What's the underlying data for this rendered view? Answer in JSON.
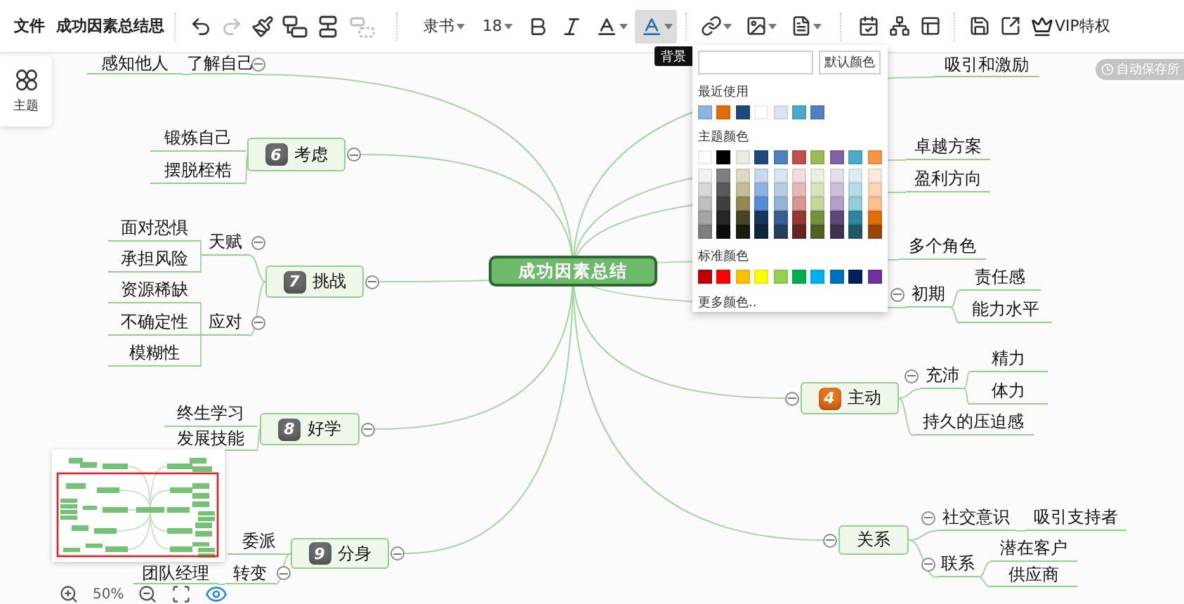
{
  "toolbar": {
    "menu": "文件",
    "title": "成功因素总结思",
    "edit_tools": [
      {
        "disabled": false
      },
      {
        "disabled": true
      },
      {
        "disabled": false
      },
      {
        "disabled": false
      },
      {
        "disabled": false
      },
      {
        "disabled": true
      }
    ],
    "font": "隶书",
    "font_size": "18",
    "format_tools": [
      {
        "active": false
      },
      {
        "active": false
      },
      {
        "active": false
      },
      {
        "active": true
      },
      {
        "active": false
      },
      {
        "active": false
      },
      {
        "active": false
      }
    ],
    "vip": "VIP特权"
  },
  "tooltip": "背景",
  "side_panel": {
    "theme_button": "主题"
  },
  "autosave": "自动保存所",
  "color_picker": {
    "default_button": "默认颜色",
    "recent_label": "最近使用",
    "recent": [
      {
        "color": "#8eb4e3"
      },
      {
        "color": "#e36c09"
      },
      {
        "color": "#1f497d"
      },
      {
        "color": "#ffffff"
      },
      {
        "color": "#dbe5f1"
      },
      {
        "color": "#4bacc6"
      },
      {
        "color": "#4f81bd"
      }
    ],
    "theme_label": "主题颜色",
    "theme_rows": [
      [
        {
          "color": "#ffffff"
        },
        {
          "color": "#000000"
        },
        {
          "color": "#eeece1"
        },
        {
          "color": "#1f497d"
        },
        {
          "color": "#4f81bd"
        },
        {
          "color": "#c0504d"
        },
        {
          "color": "#9bbb59"
        },
        {
          "color": "#8064a2"
        },
        {
          "color": "#4bacc6"
        },
        {
          "color": "#f79646"
        }
      ],
      [
        {
          "color": "#f2f2f2"
        },
        {
          "color": "#7f7f7f"
        },
        {
          "color": "#ddd9c3"
        },
        {
          "color": "#c6d9f0"
        },
        {
          "color": "#dbe5f1"
        },
        {
          "color": "#f2dcdb"
        },
        {
          "color": "#ebf1dd"
        },
        {
          "color": "#e5e0ec"
        },
        {
          "color": "#dbeef3"
        },
        {
          "color": "#fdeada"
        }
      ],
      [
        {
          "color": "#d8d8d8"
        },
        {
          "color": "#595959"
        },
        {
          "color": "#c4bd97"
        },
        {
          "color": "#8db3e2"
        },
        {
          "color": "#b8cce4"
        },
        {
          "color": "#e5b9b7"
        },
        {
          "color": "#d7e3bc"
        },
        {
          "color": "#ccc1d9"
        },
        {
          "color": "#b7dde8"
        },
        {
          "color": "#fbd5b5"
        }
      ],
      [
        {
          "color": "#bfbfbf"
        },
        {
          "color": "#3f3f3f"
        },
        {
          "color": "#938953"
        },
        {
          "color": "#548dd4"
        },
        {
          "color": "#95b3d7"
        },
        {
          "color": "#d99694"
        },
        {
          "color": "#c3d69b"
        },
        {
          "color": "#b2a2c7"
        },
        {
          "color": "#92cddc"
        },
        {
          "color": "#fac08f"
        }
      ],
      [
        {
          "color": "#a5a5a5"
        },
        {
          "color": "#262626"
        },
        {
          "color": "#494429"
        },
        {
          "color": "#17365d"
        },
        {
          "color": "#366092"
        },
        {
          "color": "#953734"
        },
        {
          "color": "#76923c"
        },
        {
          "color": "#5f497a"
        },
        {
          "color": "#31859b"
        },
        {
          "color": "#e36c09"
        }
      ],
      [
        {
          "color": "#7f7f7f"
        },
        {
          "color": "#0c0c0c"
        },
        {
          "color": "#1d1b10"
        },
        {
          "color": "#0f243e"
        },
        {
          "color": "#244061"
        },
        {
          "color": "#632423"
        },
        {
          "color": "#4f6128"
        },
        {
          "color": "#3f3151"
        },
        {
          "color": "#205867"
        },
        {
          "color": "#974806"
        }
      ]
    ],
    "standard_label": "标准颜色",
    "standard": [
      {
        "color": "#c00000"
      },
      {
        "color": "#ff0000"
      },
      {
        "color": "#ffc000"
      },
      {
        "color": "#ffff00"
      },
      {
        "color": "#92d050"
      },
      {
        "color": "#00b050"
      },
      {
        "color": "#00b0f0"
      },
      {
        "color": "#0070c0"
      },
      {
        "color": "#002060"
      },
      {
        "color": "#7030a0"
      }
    ],
    "more_link": "更多颜色.."
  },
  "mindmap": {
    "root": {
      "text": "成功因素总结",
      "kind": "center",
      "children": [
        {
          "text": "了解自己",
          "kind": "topic",
          "expanded": true,
          "children": [
            {
              "text": "感知他人",
              "kind": "topic"
            }
          ]
        },
        {
          "text": "考虑",
          "kind": "main",
          "badge": {
            "text": "6",
            "color": "#6b6b6b"
          },
          "expanded": true,
          "children": [
            {
              "text": "锻炼自己",
              "kind": "topic"
            },
            {
              "text": "摆脱桎梏",
              "kind": "topic"
            }
          ]
        },
        {
          "text": "挑战",
          "kind": "main",
          "badge": {
            "text": "7",
            "color": "#6b6b6b"
          },
          "expanded": true,
          "children": [
            {
              "text": "天赋",
              "kind": "topic",
              "expanded": true,
              "children": [
                {
                  "text": "面对恐惧",
                  "kind": "topic"
                },
                {
                  "text": "承担风险",
                  "kind": "topic"
                }
              ]
            },
            {
              "text": "应对",
              "kind": "topic",
              "expanded": true,
              "children": [
                {
                  "text": "资源稀缺",
                  "kind": "topic"
                },
                {
                  "text": "不确定性",
                  "kind": "topic"
                },
                {
                  "text": "模糊性",
                  "kind": "topic"
                }
              ]
            }
          ]
        },
        {
          "text": "好学",
          "kind": "main",
          "badge": {
            "text": "8",
            "color": "#6b6b6b"
          },
          "expanded": true,
          "children": [
            {
              "text": "终生学习",
              "kind": "topic"
            },
            {
              "text": "发展技能",
              "kind": "topic"
            }
          ]
        },
        {
          "text": "分身",
          "kind": "main",
          "badge": {
            "text": "9",
            "color": "#6b6b6b"
          },
          "expanded": true,
          "children": [
            {
              "text": "委派",
              "kind": "topic"
            },
            {
              "text": "转变",
              "kind": "topic",
              "expanded": true,
              "children": [
                {
                  "text": "团队经理",
                  "kind": "topic"
                }
              ]
            }
          ]
        },
        {
          "text": "吸引和激励",
          "kind": "topic"
        },
        {
          "text": "卓越方案",
          "kind": "topic"
        },
        {
          "text": "盈利方向",
          "kind": "topic"
        },
        {
          "text": "多个角色",
          "kind": "topic"
        },
        {
          "text": "初期",
          "kind": "topic",
          "expanded": true,
          "children": [
            {
              "text": "责任感",
              "kind": "topic"
            },
            {
              "text": "能力水平",
              "kind": "topic"
            }
          ]
        },
        {
          "text": "主动",
          "kind": "main",
          "badge": {
            "text": "4",
            "color": "#e8731a"
          },
          "expanded": true,
          "children": [
            {
              "text": "充沛",
              "kind": "topic",
              "expanded": true,
              "children": [
                {
                  "text": "精力",
                  "kind": "topic"
                },
                {
                  "text": "体力",
                  "kind": "topic"
                }
              ]
            },
            {
              "text": "持久的压迫感",
              "kind": "topic"
            }
          ]
        },
        {
          "text": "关系",
          "kind": "main",
          "expanded": true,
          "children": [
            {
              "text": "社交意识",
              "kind": "topic",
              "expanded": true,
              "children": [
                {
                  "text": "吸引支持者",
                  "kind": "topic"
                }
              ]
            },
            {
              "text": "联系",
              "kind": "topic",
              "expanded": true,
              "children": [
                {
                  "text": "潜在客户",
                  "kind": "topic"
                },
                {
                  "text": "供应商",
                  "kind": "topic"
                }
              ]
            }
          ]
        }
      ]
    }
  },
  "zoom": {
    "level": "50%"
  }
}
